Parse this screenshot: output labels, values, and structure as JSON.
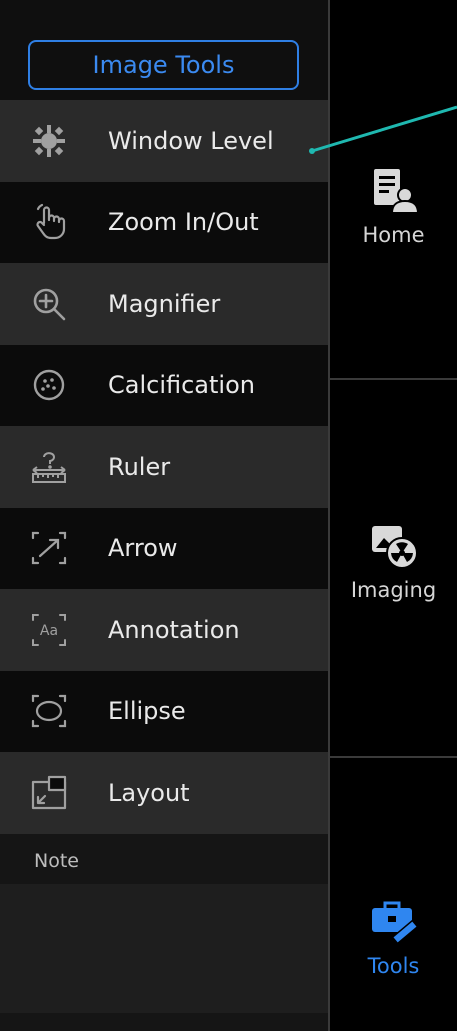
{
  "panel": {
    "title": "Image Tools",
    "tools": [
      {
        "label": "Window Level",
        "icon": "brightness-gear-icon"
      },
      {
        "label": "Zoom In/Out",
        "icon": "hand-pointer-icon"
      },
      {
        "label": "Magnifier",
        "icon": "magnifier-plus-icon"
      },
      {
        "label": "Calcification",
        "icon": "dotted-circle-icon"
      },
      {
        "label": "Ruler",
        "icon": "ruler-icon"
      },
      {
        "label": "Arrow",
        "icon": "arrow-icon"
      },
      {
        "label": "Annotation",
        "icon": "annotation-text-icon"
      },
      {
        "label": "Ellipse",
        "icon": "ellipse-icon"
      },
      {
        "label": "Layout",
        "icon": "layout-icon"
      }
    ],
    "note_label": "Note"
  },
  "nav": {
    "home_label": "Home",
    "imaging_label": "Imaging",
    "tools_label": "Tools"
  },
  "colors": {
    "accent": "#2f86f0",
    "pointer": "#1fb8b0"
  }
}
